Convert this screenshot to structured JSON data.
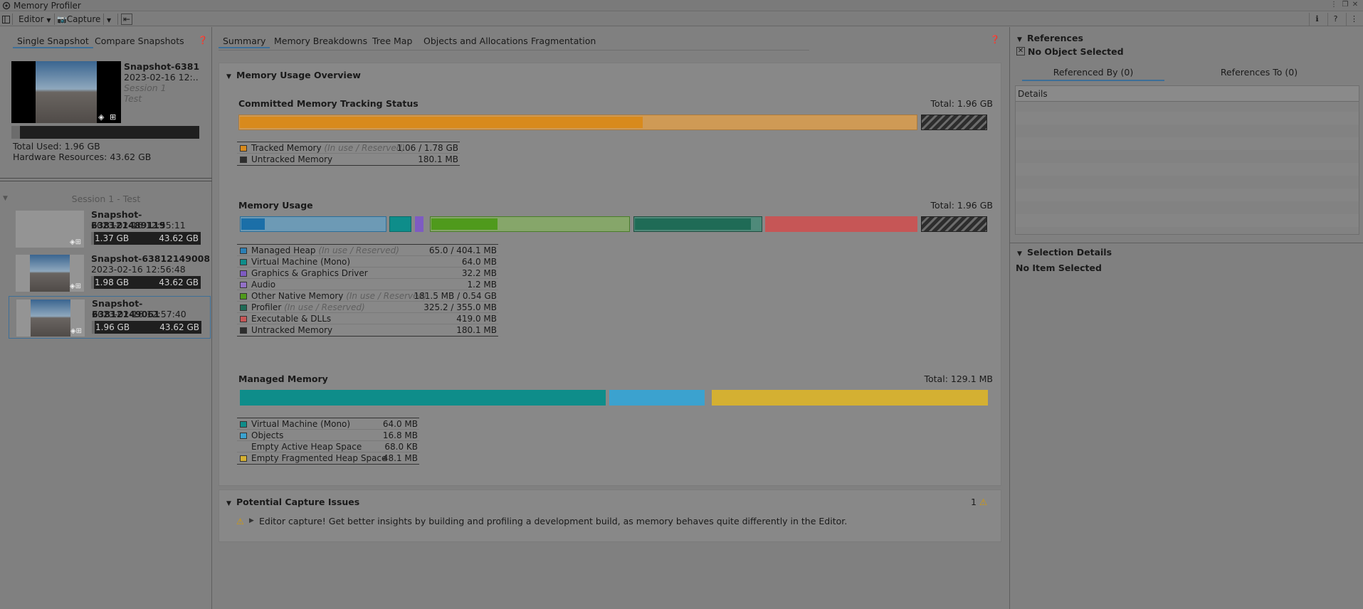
{
  "window": {
    "title": "Memory Profiler"
  },
  "toolbar": {
    "target_label": "Editor",
    "capture_label": "Capture"
  },
  "left": {
    "tabs": [
      "Single Snapshot",
      "Compare Snapshots"
    ],
    "current": {
      "name": "Snapshot-6381",
      "date": "2023-02-16 12:..",
      "session": "Session 1",
      "project": "Test",
      "total_used": "Total Used: 1.96 GB",
      "hardware": "Hardware Resources: 43.62 GB"
    },
    "session_title": "Session 1 - Test",
    "snapshots": [
      {
        "name": "Snapshot-638121489119",
        "date": "2023-02-16 12:55:11",
        "used": "1.37 GB",
        "total": "43.62 GB"
      },
      {
        "name": "Snapshot-63812149008",
        "date": "2023-02-16 12:56:48",
        "used": "1.98 GB",
        "total": "43.62 GB"
      },
      {
        "name": "Snapshot-63812149061",
        "date": "2023-02-16 12:57:40",
        "used": "1.96 GB",
        "total": "43.62 GB"
      }
    ]
  },
  "center": {
    "tabs": [
      "Summary",
      "Memory Breakdowns",
      "Tree Map",
      "Objects and Allocations",
      "Fragmentation"
    ],
    "overview_title": "Memory Usage Overview",
    "tracking": {
      "title": "Committed Memory Tracking Status",
      "total": "Total: 1.96 GB",
      "legend": [
        {
          "name": "Tracked Memory",
          "note": "(In use / Reserved)",
          "value": "1.06 / 1.78 GB",
          "color": "#d88a1c"
        },
        {
          "name": "Untracked Memory",
          "note": "",
          "value": "180.1 MB",
          "color": "#2d2d2d"
        }
      ]
    },
    "usage": {
      "title": "Memory Usage",
      "total": "Total: 1.96 GB",
      "legend": [
        {
          "name": "Managed Heap",
          "note": "(In use / Reserved)",
          "value": "65.0 / 404.1 MB",
          "color": "#2b7fb5"
        },
        {
          "name": "Virtual Machine (Mono)",
          "note": "",
          "value": "64.0 MB",
          "color": "#0e8d8a"
        },
        {
          "name": "Graphics & Graphics Driver",
          "note": "",
          "value": "32.2 MB",
          "color": "#7e5bc2"
        },
        {
          "name": "Audio",
          "note": "",
          "value": "1.2 MB",
          "color": "#9370c8"
        },
        {
          "name": "Other Native Memory",
          "note": "(In use / Reserved)",
          "value": "181.5 MB / 0.54 GB",
          "color": "#4f9a1c"
        },
        {
          "name": "Profiler",
          "note": "(In use / Reserved)",
          "value": "325.2 / 355.0 MB",
          "color": "#1f6b56"
        },
        {
          "name": "Executable & DLLs",
          "note": "",
          "value": "419.0 MB",
          "color": "#c65656"
        },
        {
          "name": "Untracked Memory",
          "note": "",
          "value": "180.1 MB",
          "color": "#2d2d2d"
        }
      ]
    },
    "managed": {
      "title": "Managed Memory",
      "total": "Total: 129.1 MB",
      "legend": [
        {
          "name": "Virtual Machine (Mono)",
          "value": "64.0 MB",
          "color": "#0e8d8a"
        },
        {
          "name": "Objects",
          "value": "16.8 MB",
          "color": "#3ba2cf"
        },
        {
          "name": "Empty Active Heap Space",
          "value": "68.0 KB",
          "color": ""
        },
        {
          "name": "Empty Fragmented Heap Space",
          "value": "48.1 MB",
          "color": "#d4b032"
        }
      ]
    },
    "issues": {
      "title": "Potential Capture Issues",
      "count": "1",
      "message": "Editor capture! Get better insights by building and profiling a development build, as memory behaves quite differently in the Editor."
    }
  },
  "right": {
    "references_title": "References",
    "no_object": "No Object Selected",
    "tabs": [
      "Referenced By (0)",
      "References To (0)"
    ],
    "details_header": "Details",
    "selection_title": "Selection Details",
    "no_item": "No Item Selected"
  }
}
